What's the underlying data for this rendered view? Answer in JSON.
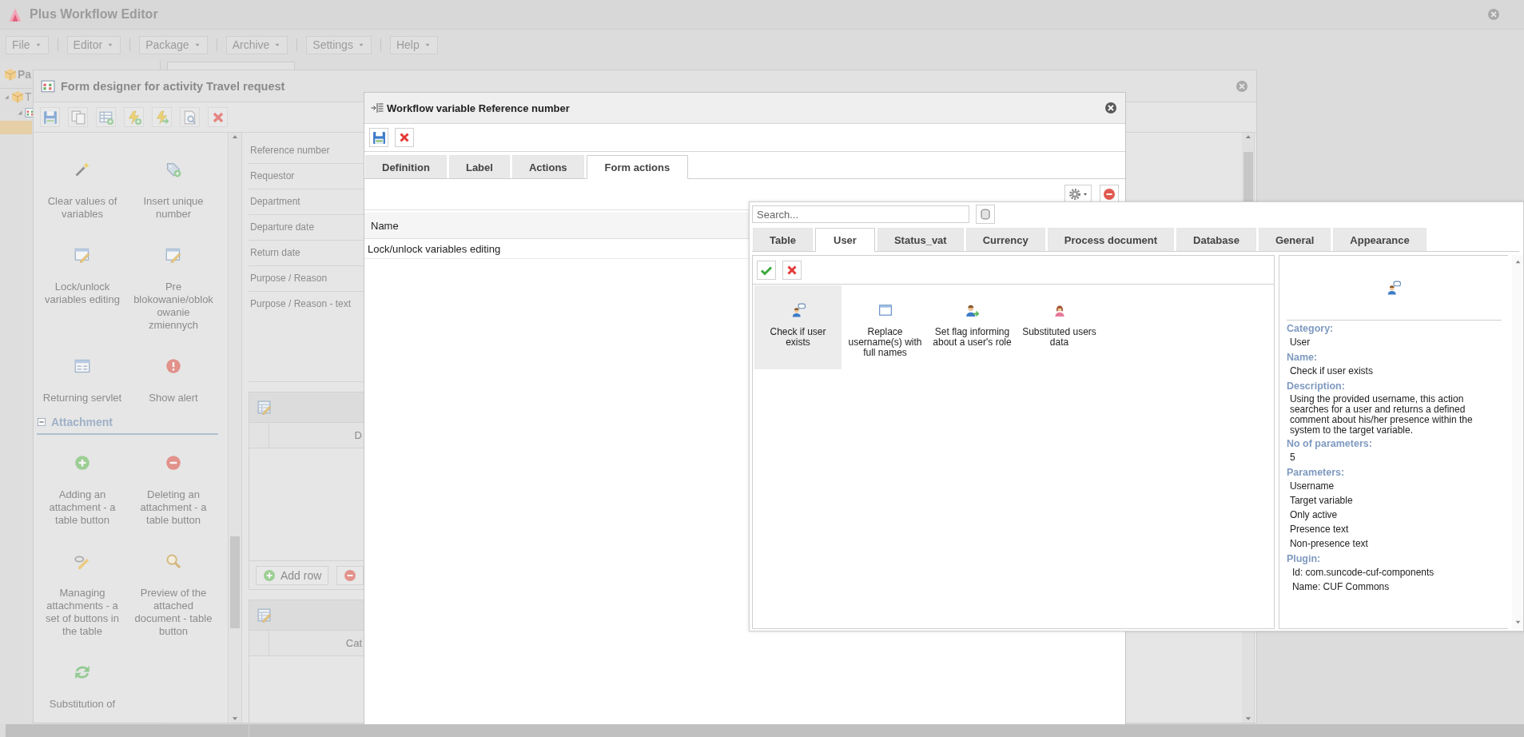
{
  "app": {
    "title": "Plus Workflow Editor",
    "menu": [
      {
        "label": "File"
      },
      {
        "label": "Editor"
      },
      {
        "label": "Package"
      },
      {
        "label": "Archive"
      },
      {
        "label": "Settings"
      },
      {
        "label": "Help"
      }
    ]
  },
  "side_panel": {
    "title": "Pa",
    "tree": [
      {
        "label": "T",
        "expanded": true
      }
    ]
  },
  "form_designer": {
    "title": "Form designer for activity Travel request",
    "palette": [
      {
        "kind": "group",
        "items": [
          {
            "label": "Clear values of variables"
          },
          {
            "label": "Insert unique number"
          },
          {
            "label": "Lock/unlock variables editing"
          },
          {
            "label": "Pre blokowanie/oblokowanie zmiennych"
          },
          {
            "label": "Returning servlet"
          },
          {
            "label": "Show alert"
          }
        ]
      },
      {
        "kind": "section",
        "title": "Attachment",
        "expanded": true,
        "items": [
          {
            "label": "Adding an attachment - a table button"
          },
          {
            "label": "Deleting an attachment - a table button"
          },
          {
            "label": "Managing attachments - a set of buttons in the table"
          },
          {
            "label": "Preview of the attached document - table button"
          },
          {
            "label": "Substitution of"
          }
        ]
      }
    ],
    "fields": [
      "Reference number",
      "Requestor",
      "Department",
      "Departure date",
      "Return date",
      "Purpose / Reason",
      "Purpose / Reason - text"
    ],
    "grids": [
      {
        "column": "D",
        "buttons": [
          {
            "label": "Add row"
          }
        ]
      },
      {
        "column": "Cat"
      }
    ]
  },
  "dialog": {
    "title": "Workflow variable Reference number",
    "tabs": [
      {
        "label": "Definition",
        "selected": false
      },
      {
        "label": "Label",
        "selected": false
      },
      {
        "label": "Actions",
        "selected": false
      },
      {
        "label": "Form actions",
        "selected": true
      }
    ],
    "table": {
      "columns": [
        "Name"
      ],
      "rows": [
        [
          "Lock/unlock variables editing"
        ]
      ]
    }
  },
  "action_picker": {
    "search": {
      "placeholder": "Search..."
    },
    "tabs": [
      {
        "label": "Table",
        "selected": false
      },
      {
        "label": "User",
        "selected": true
      },
      {
        "label": "Status_vat",
        "selected": false
      },
      {
        "label": "Currency",
        "selected": false
      },
      {
        "label": "Process document",
        "selected": false
      },
      {
        "label": "Database",
        "selected": false
      },
      {
        "label": "General",
        "selected": false
      },
      {
        "label": "Appearance",
        "selected": false
      }
    ],
    "items": [
      {
        "label": "Check if user exists",
        "selected": true
      },
      {
        "label": "Replace username(s) with full names",
        "selected": false
      },
      {
        "label": "Set flag informing about a user's role",
        "selected": false
      },
      {
        "label": "Substituted users data",
        "selected": false
      }
    ],
    "details": [
      {
        "heading": "Category:",
        "kind": "plain",
        "lines": [
          "User"
        ]
      },
      {
        "heading": "Name:",
        "kind": "plain",
        "lines": [
          "Check if user exists"
        ]
      },
      {
        "heading": "Description:",
        "kind": "paragraph",
        "lines": [
          "Using the provided username, this action searches for a user and returns a defined comment about his/her presence within the system to the target variable."
        ]
      },
      {
        "heading": "No of parameters:",
        "kind": "plain",
        "lines": [
          "5"
        ]
      },
      {
        "heading": "Parameters:",
        "kind": "plain",
        "lines": [
          "Username",
          "Target variable",
          "Only active",
          "Presence text",
          "Non-presence text"
        ]
      },
      {
        "heading": "Plugin:",
        "kind": "nested",
        "lines": [
          "Id: com.suncode-cuf-components",
          "Name: CUF Commons"
        ]
      }
    ]
  }
}
